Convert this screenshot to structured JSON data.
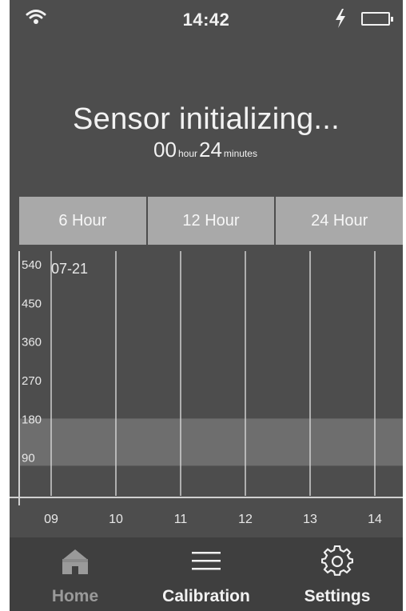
{
  "status_bar": {
    "time": "14:42",
    "wifi_icon": "wifi-icon",
    "charging_icon": "lightning-icon",
    "battery_icon": "battery-icon",
    "battery_level": 0.0
  },
  "sensor": {
    "title": "Sensor initializing...",
    "hours_value": "00",
    "hours_unit": "hour",
    "minutes_value": "24",
    "minutes_unit": "minutes"
  },
  "range_tabs": [
    {
      "label": "6 Hour"
    },
    {
      "label": "12 Hour"
    },
    {
      "label": "24 Hour"
    }
  ],
  "chart_data": {
    "type": "line",
    "date_label": "07-21",
    "y_ticks": [
      540,
      450,
      360,
      270,
      180,
      90
    ],
    "ylim": [
      0,
      540
    ],
    "target_range": [
      70,
      180
    ],
    "x_ticks": [
      "09",
      "10",
      "11",
      "12",
      "13",
      "14"
    ],
    "series": [],
    "grid": true,
    "colors": {
      "band": "#6e6e6e",
      "grid": "#d0d0d0",
      "text": "#e8e8e8"
    }
  },
  "nav": {
    "items": [
      {
        "label": "Home",
        "icon": "home-icon",
        "active": true
      },
      {
        "label": "Calibration",
        "icon": "menu-lines-icon",
        "active": false
      },
      {
        "label": "Settings",
        "icon": "gear-icon",
        "active": false
      }
    ]
  }
}
